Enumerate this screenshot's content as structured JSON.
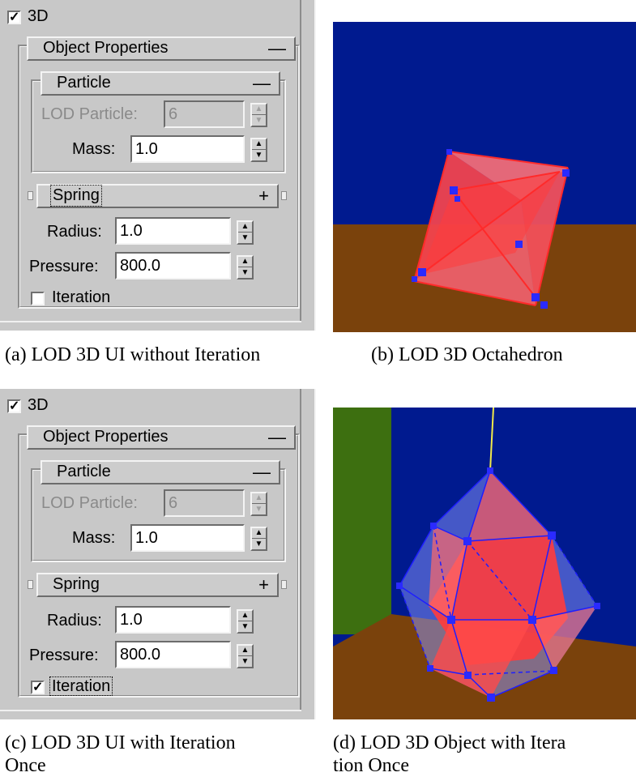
{
  "panels": [
    {
      "enable_3d_label": "3D",
      "enable_3d_checked": true,
      "object_properties_label": "Object Properties",
      "object_properties_sign": "—",
      "particle_label": "Particle",
      "particle_sign": "—",
      "lod_particle_label": "LOD Particle:",
      "lod_particle_value": "6",
      "mass_label": "Mass:",
      "mass_value": "1.0",
      "spring_label": "Spring",
      "spring_sign": "+",
      "radius_label": "Radius:",
      "radius_value": "1.0",
      "pressure_label": "Pressure:",
      "pressure_value": "800.0",
      "iteration_label": "Iteration",
      "iteration_checked": false,
      "caption": "(a) LOD 3D UI without Iteration"
    },
    {
      "enable_3d_label": "3D",
      "enable_3d_checked": true,
      "object_properties_label": "Object Properties",
      "object_properties_sign": "—",
      "particle_label": "Particle",
      "particle_sign": "—",
      "lod_particle_label": "LOD Particle:",
      "lod_particle_value": "6",
      "mass_label": "Mass:",
      "mass_value": "1.0",
      "spring_label": "Spring",
      "spring_sign": "+",
      "radius_label": "Radius:",
      "radius_value": "1.0",
      "pressure_label": "Pressure:",
      "pressure_value": "800.0",
      "iteration_label": "Iteration",
      "iteration_checked": true,
      "caption_line1": "(c) LOD 3D UI with Iteration",
      "caption_line2": "Once"
    }
  ],
  "scenes": [
    {
      "caption": "(b) LOD 3D Octahedron"
    },
    {
      "caption_line1": "(d) LOD 3D Object with Itera",
      "caption_line2": "tion Once"
    }
  ],
  "colors": {
    "sky": "#001a8f",
    "floor": "#7a420c",
    "wall": "#3d6f10",
    "mesh_red": "#ff3c3c",
    "mesh_blue": "#1e1eff",
    "hull_blue": "#8a96ff",
    "hang_line": "#f2ea4a"
  },
  "icons": [
    "checkbox-checked-icon",
    "checkbox-unchecked-icon",
    "collapse-icon",
    "expand-icon",
    "spin-up-icon",
    "spin-down-icon"
  ]
}
